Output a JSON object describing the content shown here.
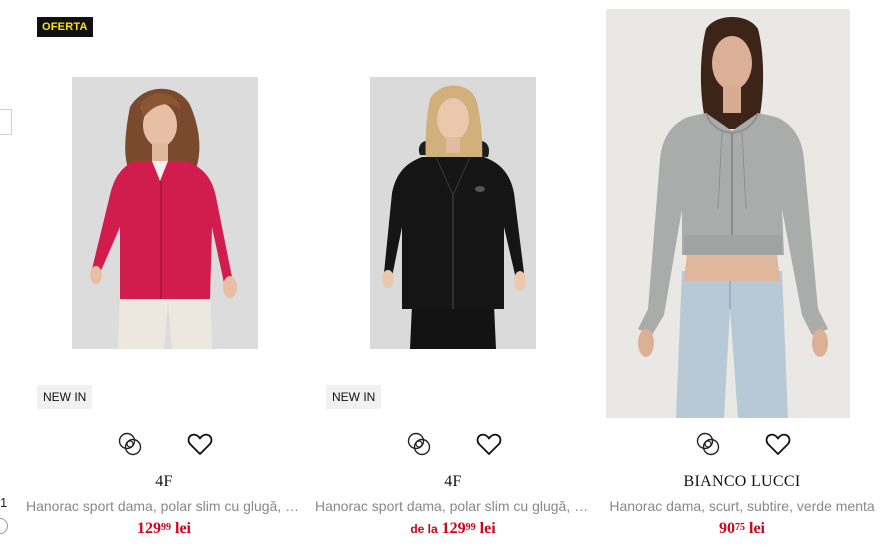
{
  "edge": {
    "number": "1"
  },
  "products": [
    {
      "offer_badge": "OFERTA",
      "new_badge": "NEW IN",
      "brand": "4F",
      "description": "Hanorac sport dama, polar slim cu glugă, fucsia",
      "price_prefix": "",
      "price_int": "129",
      "price_dec": "99",
      "currency": "lei",
      "garment_color": "#d11d4e"
    },
    {
      "new_badge": "NEW IN",
      "brand": "4F",
      "description": "Hanorac sport dama, polar slim cu glugă, negru",
      "price_prefix": "de la",
      "price_int": "129",
      "price_dec": "99",
      "currency": "lei",
      "garment_color": "#151515"
    },
    {
      "brand": "BIANCO LUCCI",
      "description": "Hanorac dama, scurt, subtire, verde menta",
      "price_prefix": "",
      "price_int": "90",
      "price_dec": "75",
      "currency": "lei",
      "garment_color": "#a9acaa"
    }
  ],
  "icons": {
    "compare": "compare-circles-icon",
    "wishlist": "heart-outline-icon"
  },
  "colors": {
    "price": "#d0021b",
    "offer_text": "#ffe300",
    "offer_bg": "#111111"
  }
}
